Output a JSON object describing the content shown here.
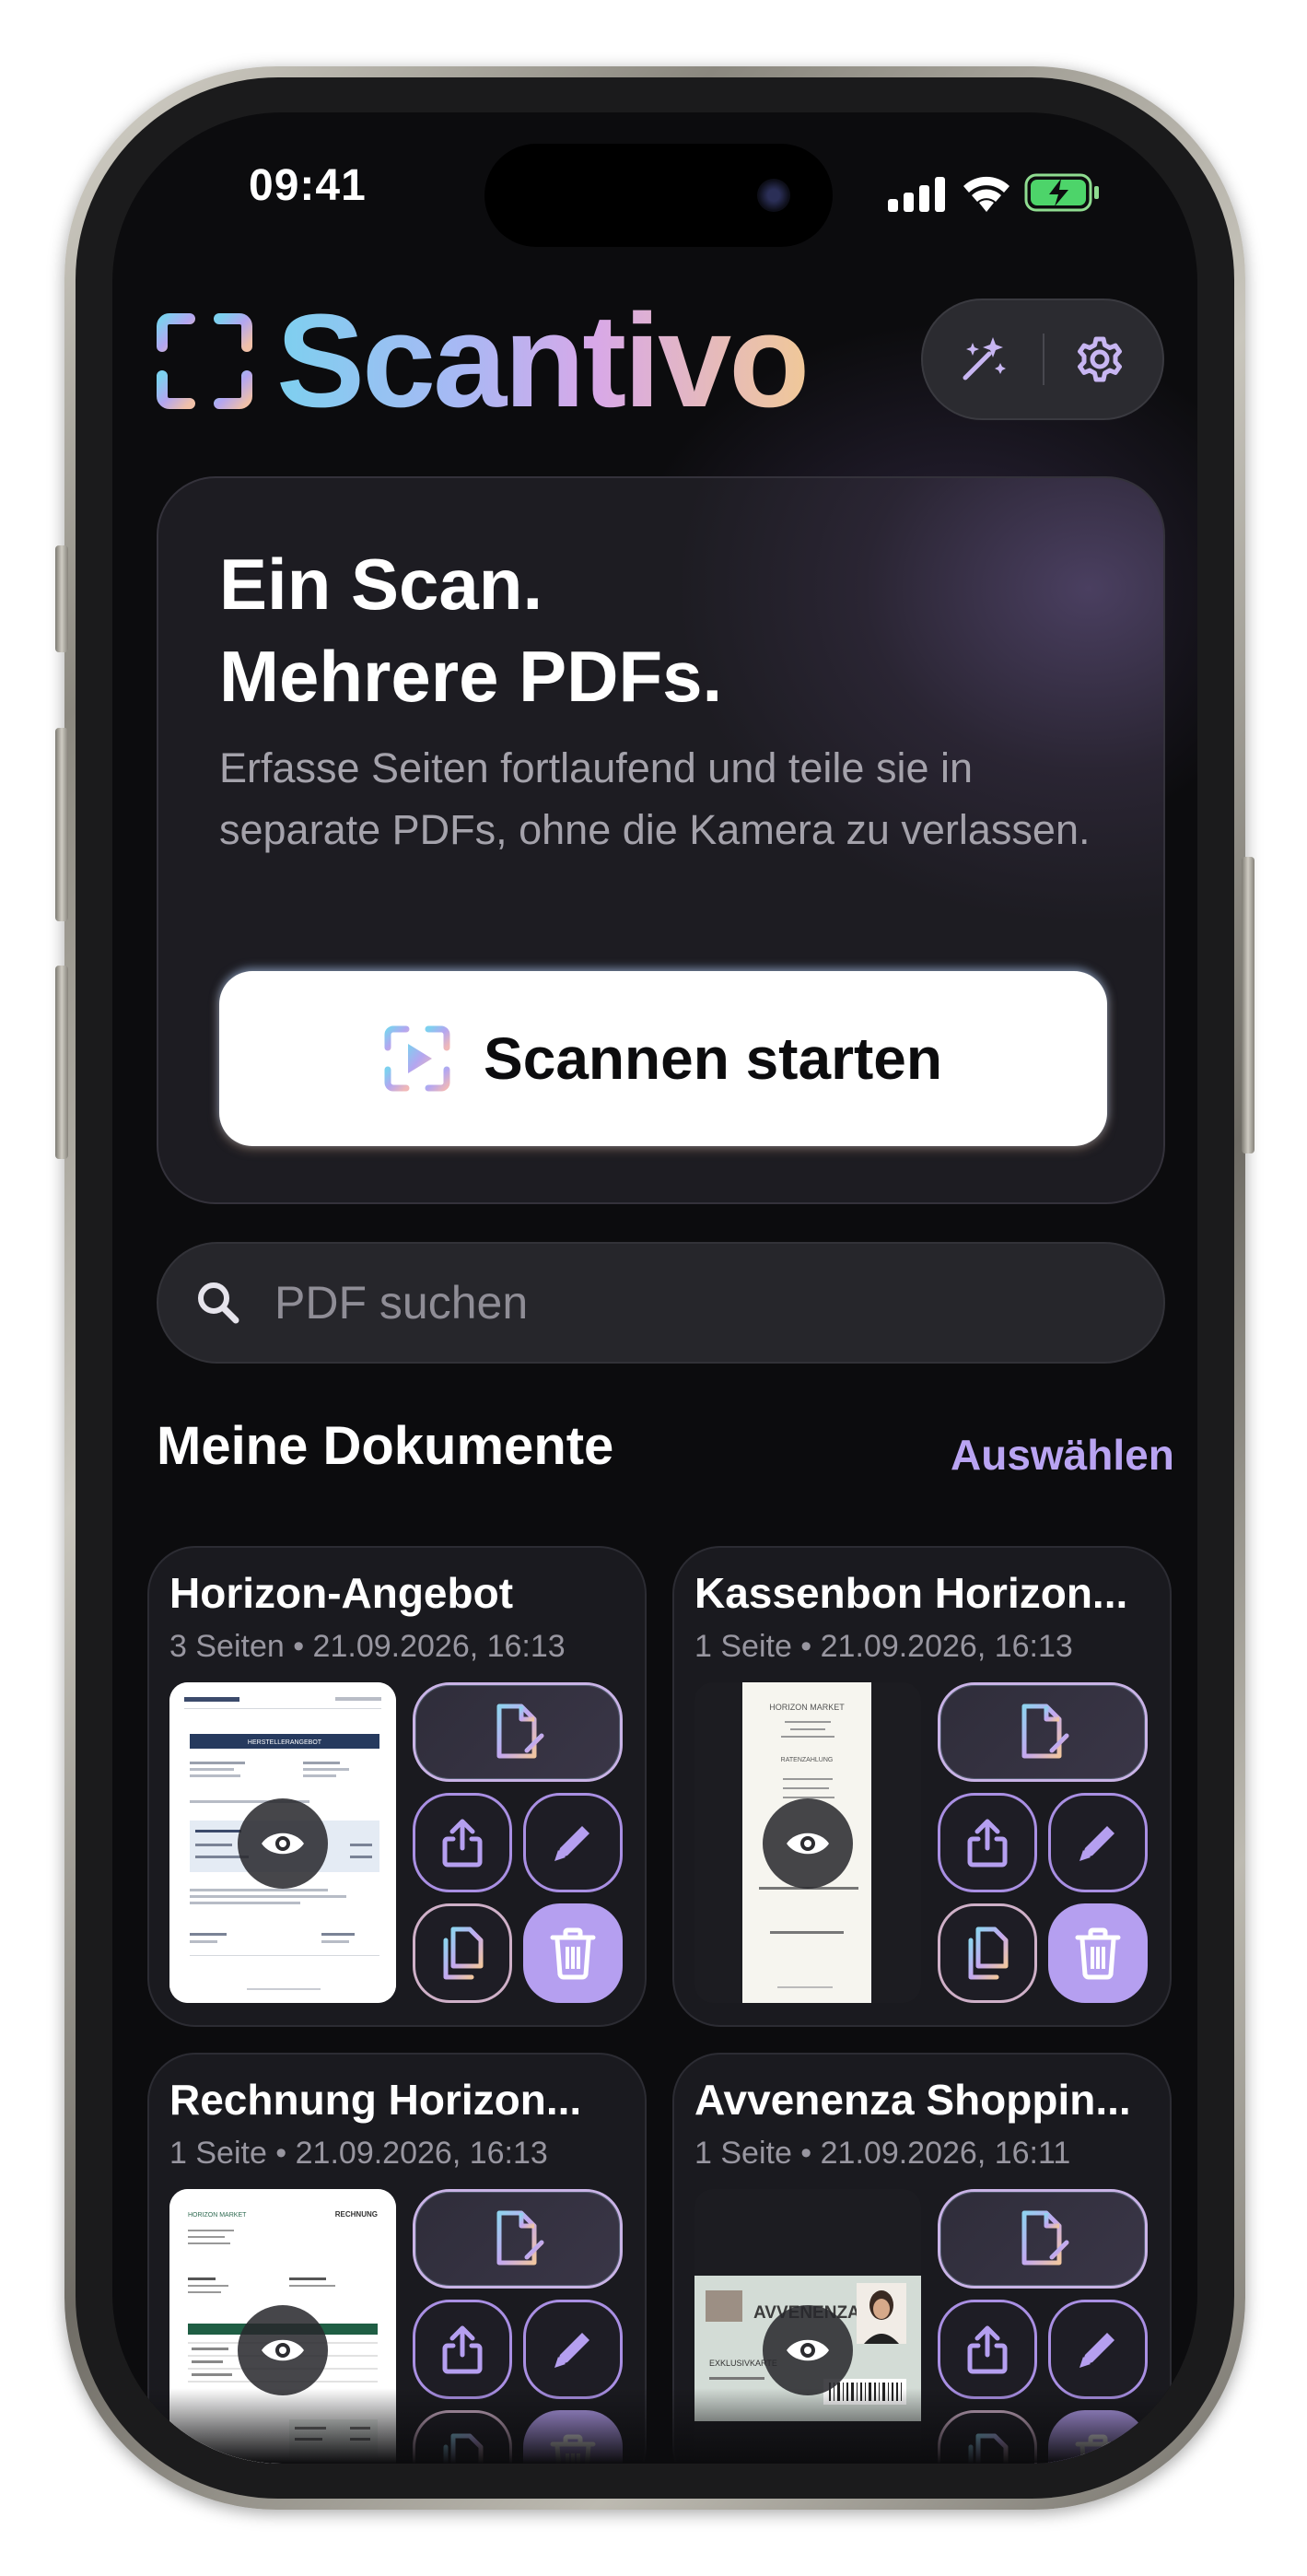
{
  "status_bar": {
    "time": "09:41"
  },
  "header": {
    "app_name": "Scantivo",
    "magic_icon": "sparkle-wand-icon",
    "settings_icon": "gear-icon"
  },
  "hero": {
    "title_line1": "Ein Scan.",
    "title_line2": "Mehrere PDFs.",
    "subtitle": "Erfasse Seiten fortlaufend und teile sie in separate PDFs, ohne die Kamera zu verlassen.",
    "button_label": "Scannen starten"
  },
  "search": {
    "placeholder": "PDF suchen"
  },
  "documents_section": {
    "title": "Meine Dokumente",
    "select_label": "Auswählen"
  },
  "documents": [
    {
      "title": "Horizon-Angebot",
      "meta": "3 Seiten • 21.09.2026, 16:13"
    },
    {
      "title": "Kassenbon Horizon...",
      "meta": "1 Seite • 21.09.2026, 16:13"
    },
    {
      "title": "Rechnung Horizon...",
      "meta": "1 Seite • 21.09.2026, 16:13"
    },
    {
      "title": "Avvenenza Shoppin...",
      "meta": "1 Seite • 21.09.2026, 16:11"
    }
  ],
  "thumbnails": {
    "offer_heading": "HERSTELLERANGEBOT",
    "receipt_heading": "HORIZON MARKET",
    "receipt_subheading": "RATENZAHLUNG",
    "invoice_brand": "HORIZON MARKET",
    "invoice_heading": "RECHNUNG",
    "card_brand": "AVVENENZA",
    "card_caption": "EXKLUSIVKARTE"
  },
  "colors": {
    "accent": "#b9a4f2",
    "background": "#0c0c0e",
    "card": "#1a1a1f",
    "trash_button": "#b59ff0"
  }
}
